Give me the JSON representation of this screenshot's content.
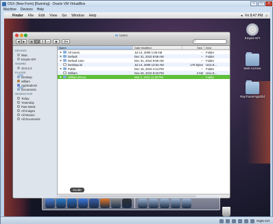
{
  "host": {
    "title": "OSX (New Form) [Running] - Oracle VM VirtualBox",
    "menu": [
      "Machine",
      "Devices",
      "Help"
    ],
    "status_key": "Right Ctrl"
  },
  "mac": {
    "menubar": [
      "Finder",
      "File",
      "Edit",
      "View",
      "Go",
      "Window",
      "Help"
    ],
    "clock": "Fri 8:47 PM"
  },
  "desktop_icons": [
    {
      "label": "Empire EFI",
      "icon": "cd-icon"
    },
    {
      "label": "Web Archive",
      "icon": "folder-icon"
    },
    {
      "label": "RayTracerAppOld",
      "icon": "folder-icon"
    }
  ],
  "finder": {
    "title": "Users",
    "sidebar": [
      {
        "section": "DEVICES",
        "items": [
          {
            "label": "iMac",
            "icon": "hd"
          },
          {
            "label": "Empire EFI",
            "icon": "hd"
          }
        ]
      },
      {
        "section": "SHARED",
        "items": [
          {
            "label": "10.0.2.2",
            "icon": "hd"
          }
        ]
      },
      {
        "section": "PLACES",
        "items": [
          {
            "label": "Desktop",
            "icon": "folder"
          },
          {
            "label": "william",
            "icon": "home"
          },
          {
            "label": "Applications",
            "icon": "app"
          },
          {
            "label": "Documents",
            "icon": "folder"
          }
        ]
      },
      {
        "section": "SEARCH FOR",
        "items": [
          {
            "label": "Today",
            "icon": "search"
          },
          {
            "label": "Yesterday",
            "icon": "search"
          },
          {
            "label": "Past Week",
            "icon": "search"
          },
          {
            "label": "All Images",
            "icon": "search"
          },
          {
            "label": "All Movies",
            "icon": "search"
          },
          {
            "label": "All Documents",
            "icon": "search"
          }
        ]
      }
    ],
    "columns": {
      "name": "Name",
      "date": "Date Modified",
      "size": "Size",
      "kind": "Kind"
    },
    "rows": [
      {
        "name": "All Users",
        "date": "Jul 14, 2009 1:08 AM",
        "size": "--",
        "kind": "Folder",
        "expandable": true,
        "type": "folder"
      },
      {
        "name": "Default",
        "date": "Dec 31, 2010 9:59 AM",
        "size": "--",
        "kind": "Folder",
        "expandable": true,
        "type": "folder"
      },
      {
        "name": "Default User",
        "date": "Dec 31, 2010 9:59 AM",
        "size": "--",
        "kind": "Folder",
        "expandable": true,
        "type": "folder"
      },
      {
        "name": "Desktop.ini",
        "date": "Jul 14, 2009 12:54 AM",
        "size": "176 bytes",
        "kind": "Unix E...",
        "expandable": false,
        "type": "doc"
      },
      {
        "name": "Public",
        "date": "Dec 16, 2010 4:14 PM",
        "size": "--",
        "kind": "Folder",
        "expandable": true,
        "type": "folder"
      },
      {
        "name": "William",
        "date": "Nov 26, 2010 8:33 PM",
        "size": "4 KB",
        "kind": "Unix E...",
        "expandable": false,
        "type": "doc"
      },
      {
        "name": "William Breza",
        "date": "Mar 2, 2011 11:28 PM",
        "size": "--",
        "kind": "Folder",
        "expandable": true,
        "type": "folder",
        "selected": true
      }
    ]
  },
  "dock": {
    "tooltip": "Xcode",
    "items": [
      {
        "name": "finder-dock-icon",
        "color": "#4a7fd6"
      },
      {
        "name": "safari-dock-icon",
        "color": "#2f80d0"
      },
      {
        "name": "app-store-dock-icon",
        "color": "#2b6fc2"
      },
      {
        "name": "itunes-dock-icon",
        "color": "#3d7be0"
      },
      {
        "name": "xcode-dock-icon",
        "color": "#3a5ea8"
      },
      {
        "name": "firefox-dock-icon",
        "color": "#e2772a"
      },
      {
        "name": "system-prefs-dock-icon",
        "color": "#8d8d8d"
      },
      {
        "name": "terminal-dock-icon",
        "color": "#2f3136"
      },
      {
        "name": "stack-dock-icon-1",
        "color": "#9fb6d3"
      },
      {
        "name": "stack-dock-icon-2",
        "color": "#9fb6d3"
      },
      {
        "name": "stack-dock-icon-3",
        "color": "#9fb6d3"
      },
      {
        "name": "stack-dock-icon-4",
        "color": "#9fb6d3"
      },
      {
        "name": "stack-dock-icon-5",
        "color": "#9fb6d3"
      }
    ]
  },
  "colors": {
    "selection": "#5fbf3a",
    "accent": "#3a6db0"
  }
}
